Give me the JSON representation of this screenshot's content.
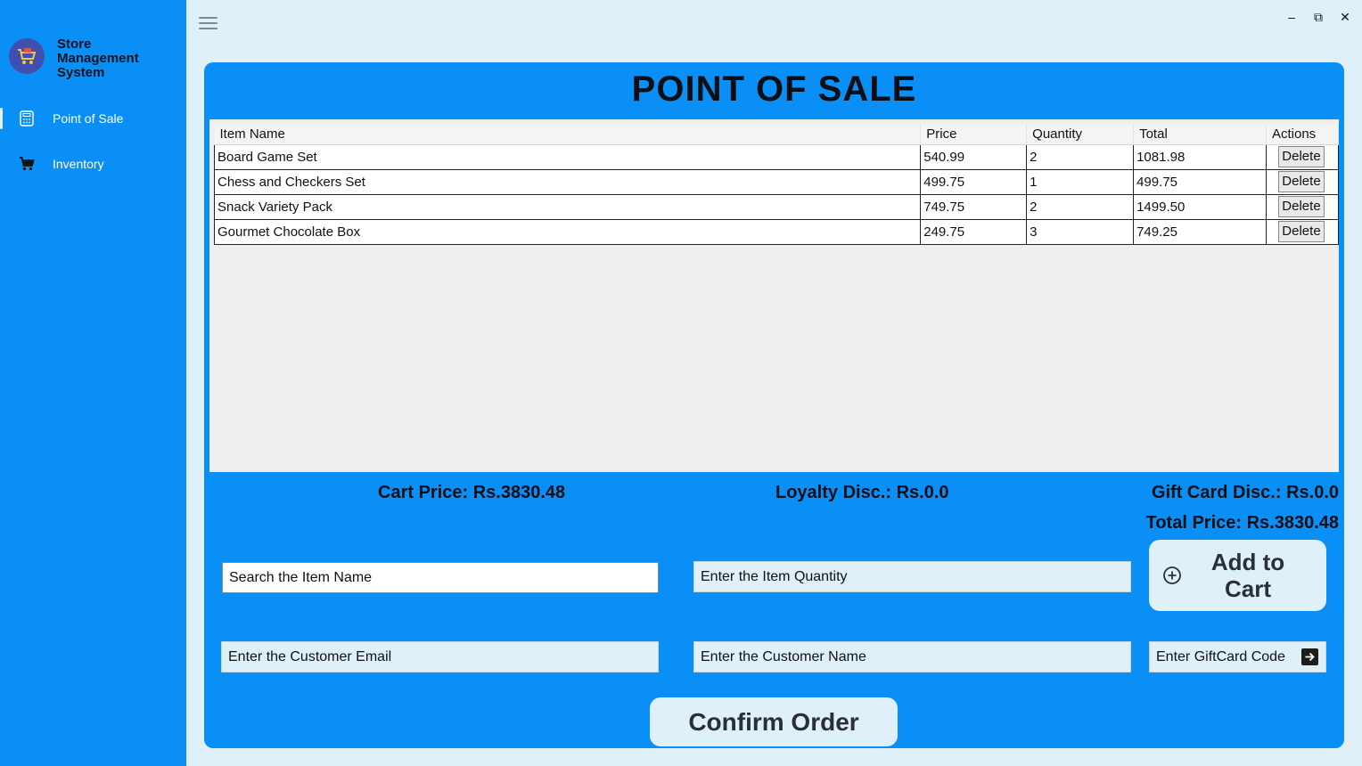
{
  "app": {
    "title": "Store Management System"
  },
  "sidebar": {
    "items": [
      {
        "label": "Point of Sale",
        "icon": "calculator-icon",
        "active": true
      },
      {
        "label": "Inventory",
        "icon": "cart-icon",
        "active": false
      }
    ]
  },
  "window": {
    "minimize": "–",
    "maximize": "⧉",
    "close": "✕"
  },
  "pos": {
    "title": "POINT OF SALE",
    "table": {
      "headers": [
        "Item Name",
        "Price",
        "Quantity",
        "Total",
        "Actions"
      ],
      "rows": [
        {
          "name": "Board Game Set",
          "price": "540.99",
          "qty": "2",
          "total": "1081.98",
          "action": "Delete"
        },
        {
          "name": "Chess and Checkers Set",
          "price": "499.75",
          "qty": "1",
          "total": "499.75",
          "action": "Delete"
        },
        {
          "name": "Snack Variety Pack",
          "price": "749.75",
          "qty": "2",
          "total": "1499.50",
          "action": "Delete"
        },
        {
          "name": "Gourmet Chocolate Box",
          "price": "249.75",
          "qty": "3",
          "total": "749.25",
          "action": "Delete"
        }
      ]
    },
    "summary": {
      "cart_price": "Cart Price: Rs.3830.48",
      "loyalty_disc": "Loyalty Disc.: Rs.0.0",
      "gift_card_disc": "Gift Card Disc.: Rs.0.0",
      "total_price": "Total Price: Rs.3830.48"
    },
    "inputs": {
      "search_placeholder": "Search the Item Name",
      "quantity_placeholder": "Enter the Item Quantity",
      "email_placeholder": "Enter the Customer Email",
      "name_placeholder": "Enter the Customer Name",
      "giftcard_placeholder": "Enter GiftCard Code"
    },
    "buttons": {
      "add_to_cart": "Add to Cart",
      "confirm_order": "Confirm Order"
    }
  },
  "colors": {
    "accent": "#0a8ff7",
    "background": "#dff0f8",
    "text": "#0b0e12"
  }
}
